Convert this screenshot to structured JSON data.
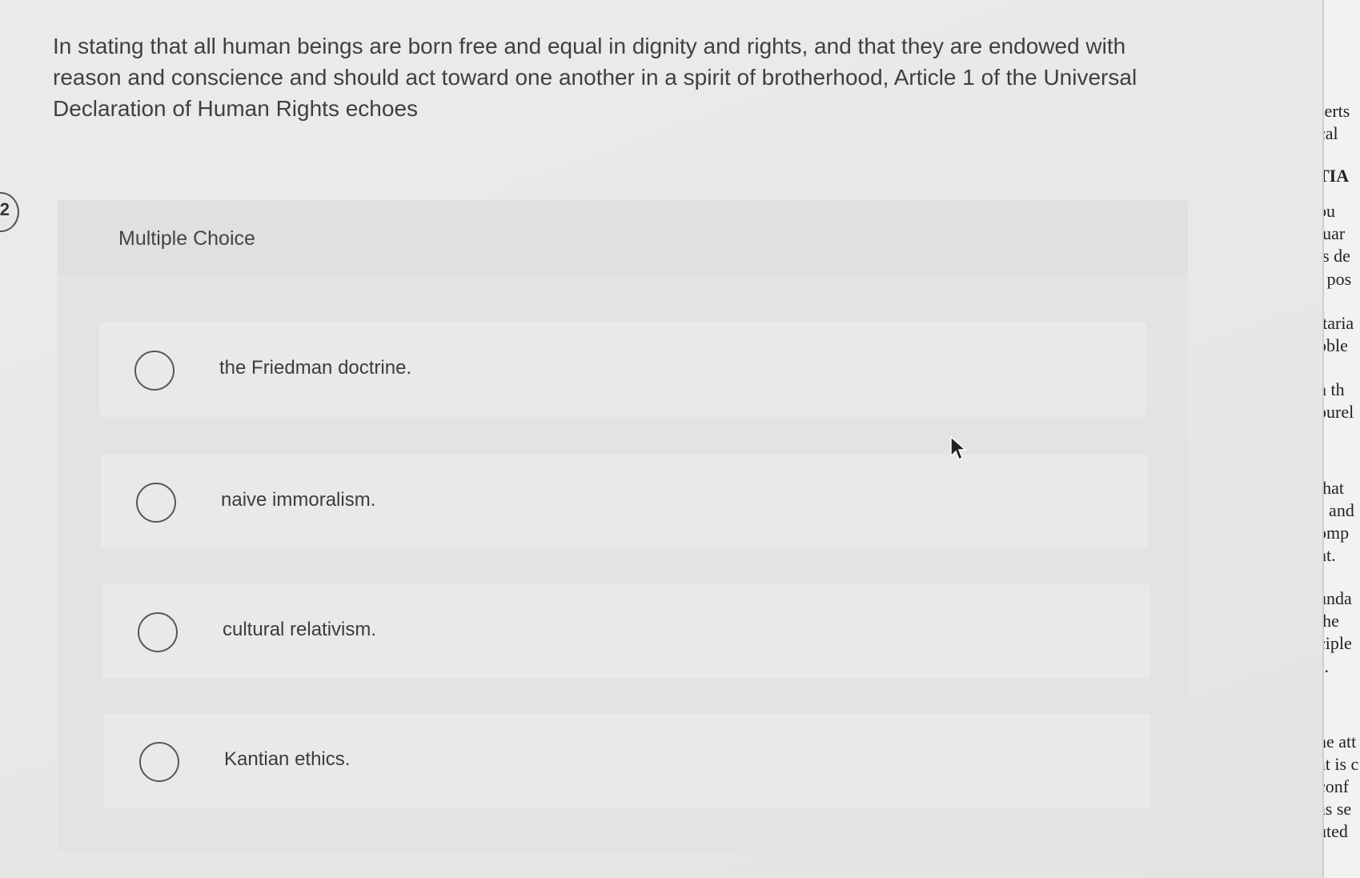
{
  "question": {
    "text": "In stating that all human beings are born free and equal in dignity and rights, and that they are endowed with reason and conscience and should act toward one another in a spirit of brotherhood, Article 1 of the Universal Declaration of Human Rights echoes"
  },
  "left_tab": {
    "label": "2"
  },
  "multiple_choice": {
    "label": "Multiple Choice",
    "options": [
      {
        "label": "the Friedman doctrine."
      },
      {
        "label": "naive immoralism."
      },
      {
        "label": "cultural relativism."
      },
      {
        "label": "Kantian ethics."
      }
    ]
  },
  "background_paper": {
    "lines": [
      "serts",
      "cal",
      "TIA",
      "bu",
      "tuar",
      "is de",
      "t pos",
      "itaria",
      "oble",
      "n th",
      "purel",
      "that",
      "s and",
      "omp",
      "nt.",
      "unda",
      "the",
      "ciple",
      "s.",
      "he att",
      "at is c",
      "conf",
      "as se",
      "uted"
    ]
  },
  "icons": {
    "cursor": "mouse-pointer-icon",
    "radio": "radio-circle-icon"
  }
}
